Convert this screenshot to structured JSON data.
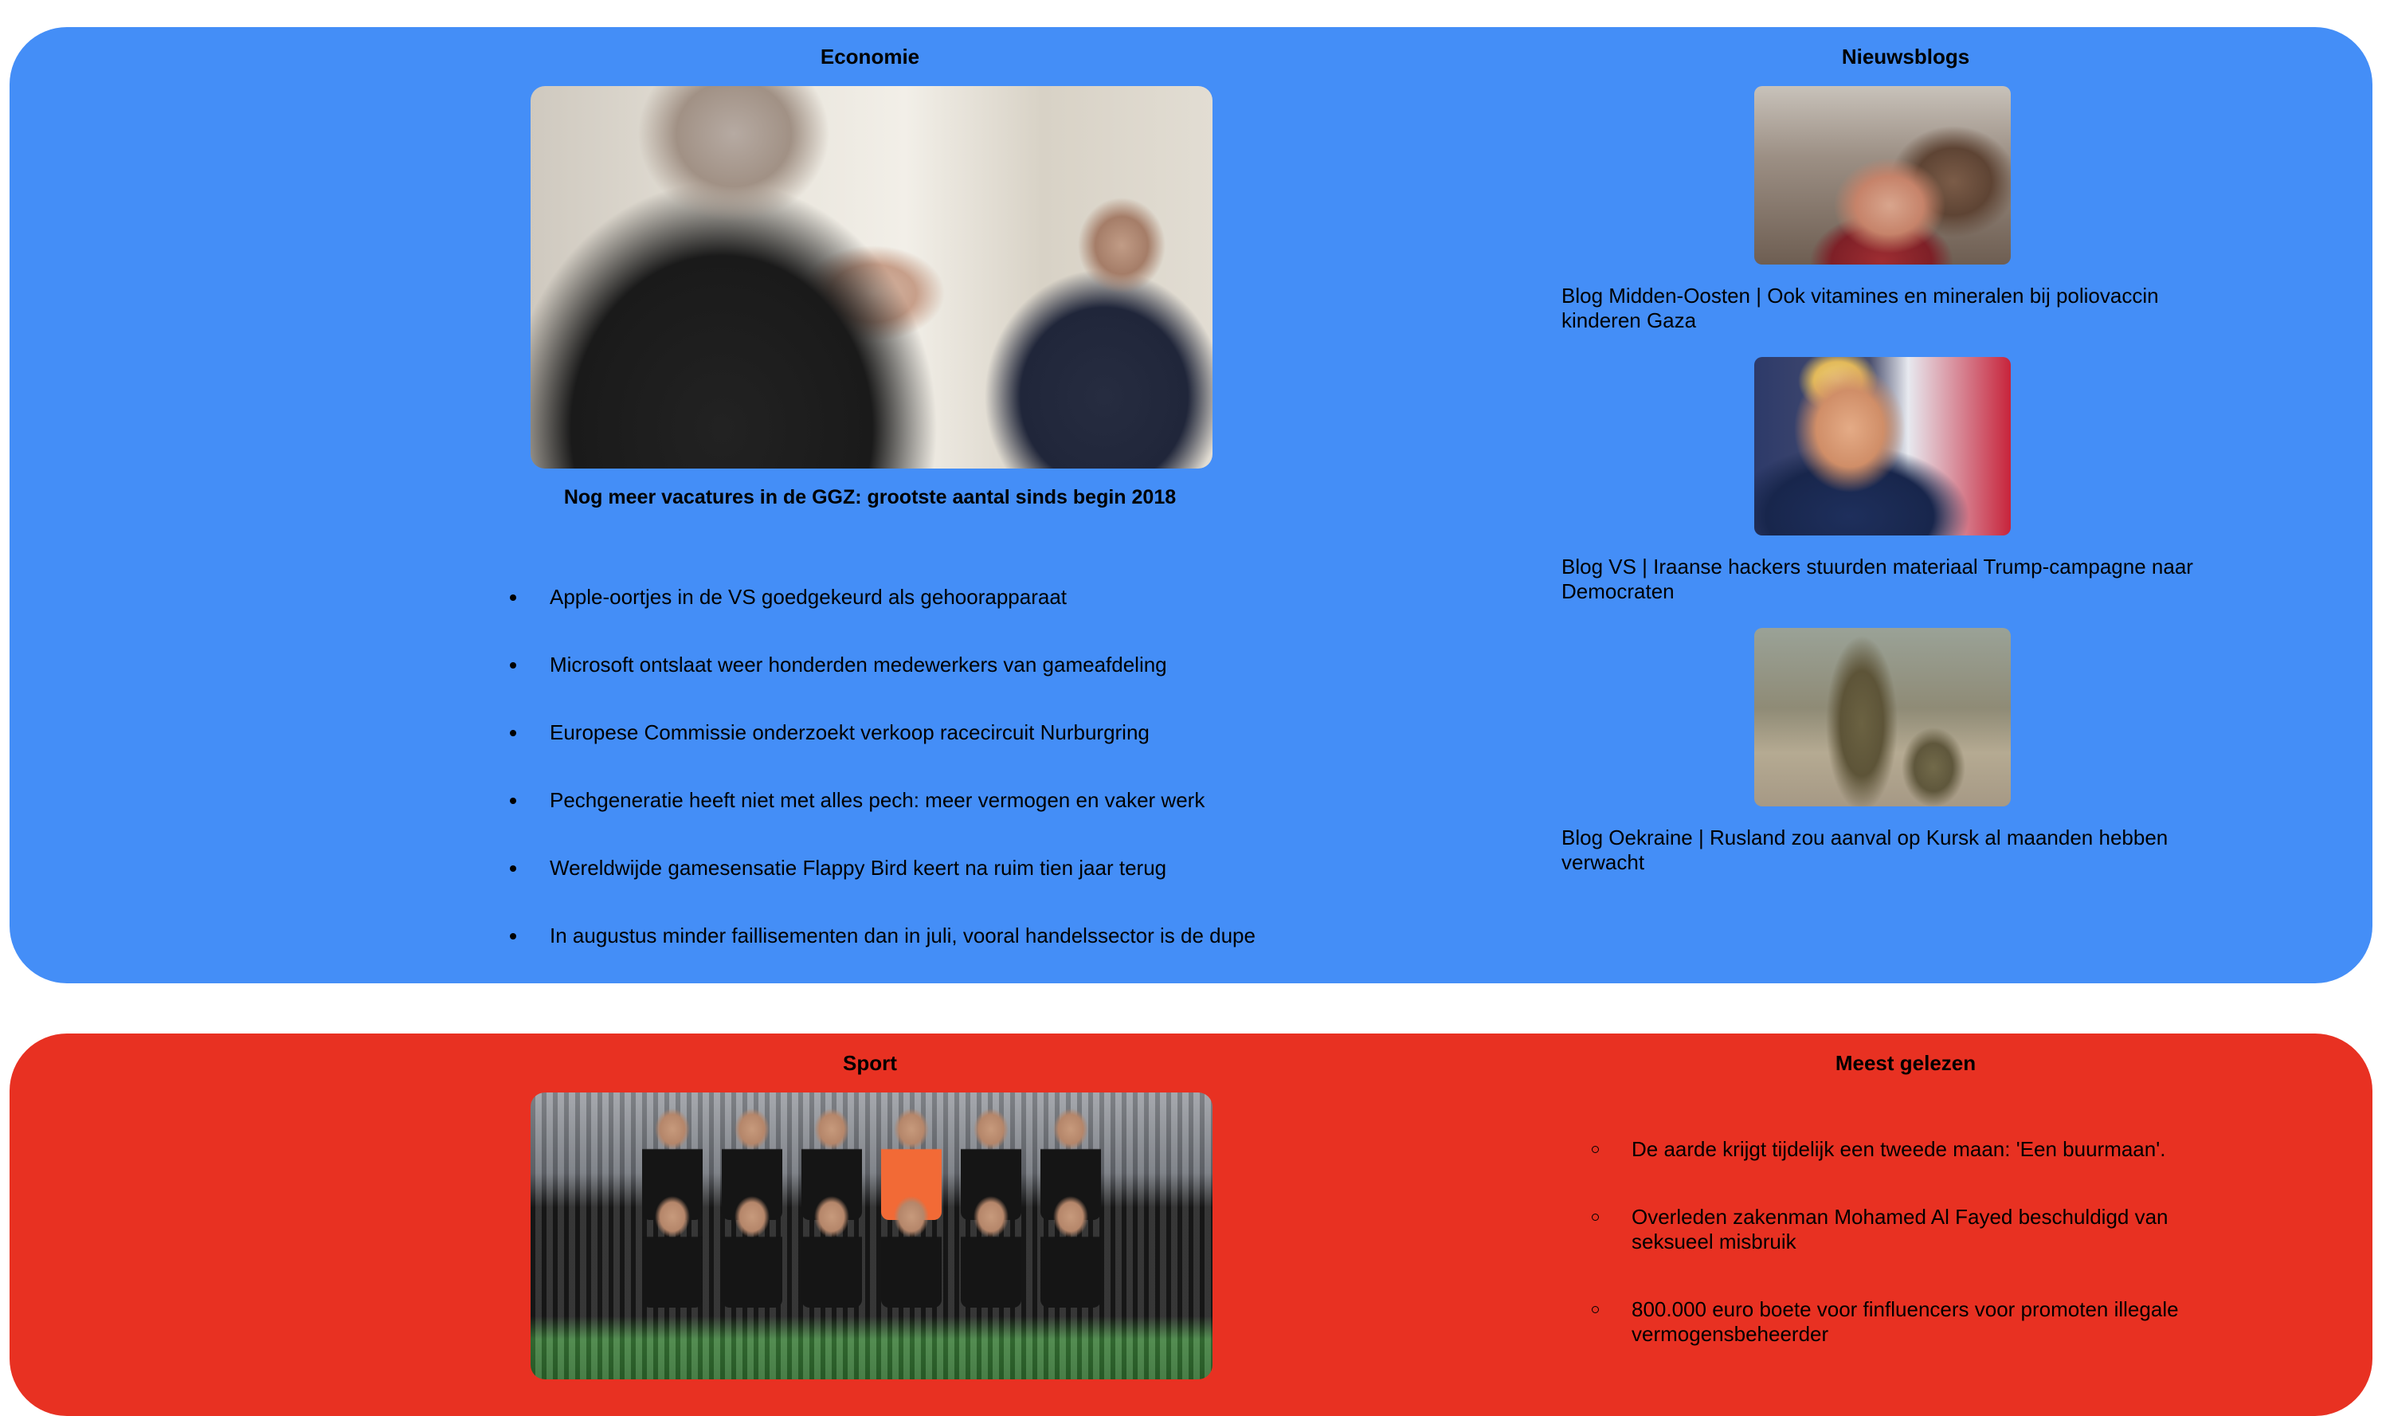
{
  "economie": {
    "heading": "Economie",
    "headline": "Nog meer vacatures in de GGZ: grootste aantal sinds begin 2018",
    "items": [
      "Apple-oortjes in de VS goedgekeurd als gehoorapparaat",
      "Microsoft ontslaat weer honderden medewerkers van gameafdeling",
      "Europese Commissie onderzoekt verkoop racecircuit Nurburgring",
      "Pechgeneratie heeft niet met alles pech: meer vermogen en vaker werk",
      "Wereldwijde gamesensatie Flappy Bird keert na ruim tien jaar terug",
      "In augustus minder faillisementen dan in juli, vooral handelssector is de dupe"
    ]
  },
  "nieuwsblogs": {
    "heading": "Nieuwsblogs",
    "items": [
      "Blog Midden-Oosten | Ook vitamines en mineralen bij poliovaccin kinderen Gaza",
      "Blog VS | Iraanse hackers stuurden materiaal Trump-campagne naar Democraten",
      "Blog Oekraine | Rusland zou aanval op Kursk al maanden hebben verwacht"
    ]
  },
  "sport": {
    "heading": "Sport"
  },
  "meest_gelezen": {
    "heading": "Meest gelezen",
    "items": [
      "De aarde krijgt tijdelijk een tweede maan: 'Een buurmaan'.",
      "Overleden zakenman Mohamed Al Fayed beschuldigd van seksueel misbruik",
      "800.000 euro boete voor finfluencers voor promoten illegale vermogensbeheerder"
    ]
  },
  "colors": {
    "blue_section": "#448ef7",
    "red_section": "#e83122"
  }
}
